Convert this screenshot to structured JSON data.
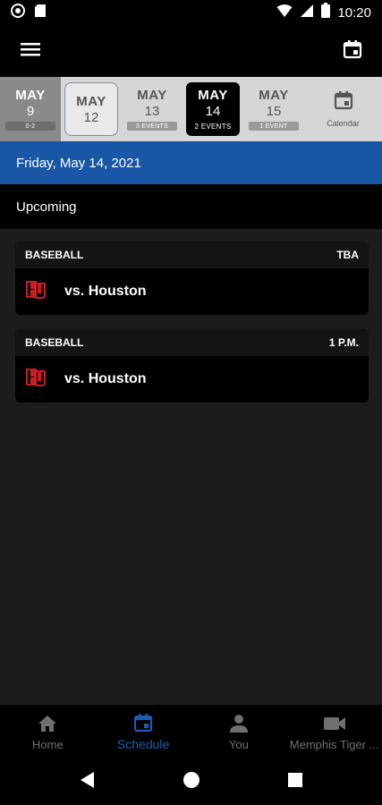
{
  "status_bar": {
    "time": "10:20"
  },
  "date_strip": {
    "days": [
      {
        "month": "MAY",
        "day": "9",
        "badge": "0-2",
        "state": "past"
      },
      {
        "month": "MAY",
        "day": "12",
        "badge": "",
        "state": "today"
      },
      {
        "month": "MAY",
        "day": "13",
        "badge": "3 EVENTS",
        "state": "normal"
      },
      {
        "month": "MAY",
        "day": "14",
        "badge": "2 EVENTS",
        "state": "selected"
      },
      {
        "month": "MAY",
        "day": "15",
        "badge": "1 EVENT",
        "state": "normal"
      }
    ],
    "calendar_label": "Calendar"
  },
  "date_header": "Friday, May 14, 2021",
  "section_title": "Upcoming",
  "events": [
    {
      "sport": "BASEBALL",
      "time": "TBA",
      "opponent": "vs. Houston"
    },
    {
      "sport": "BASEBALL",
      "time": "1 P.M.",
      "opponent": "vs. Houston"
    }
  ],
  "bottom_nav": {
    "home": "Home",
    "schedule": "Schedule",
    "you": "You",
    "memphis": "Memphis Tiger ..."
  },
  "colors": {
    "accent_blue": "#1a56a6",
    "active_nav": "#1f5bb0",
    "logo_red": "#e0202a"
  }
}
